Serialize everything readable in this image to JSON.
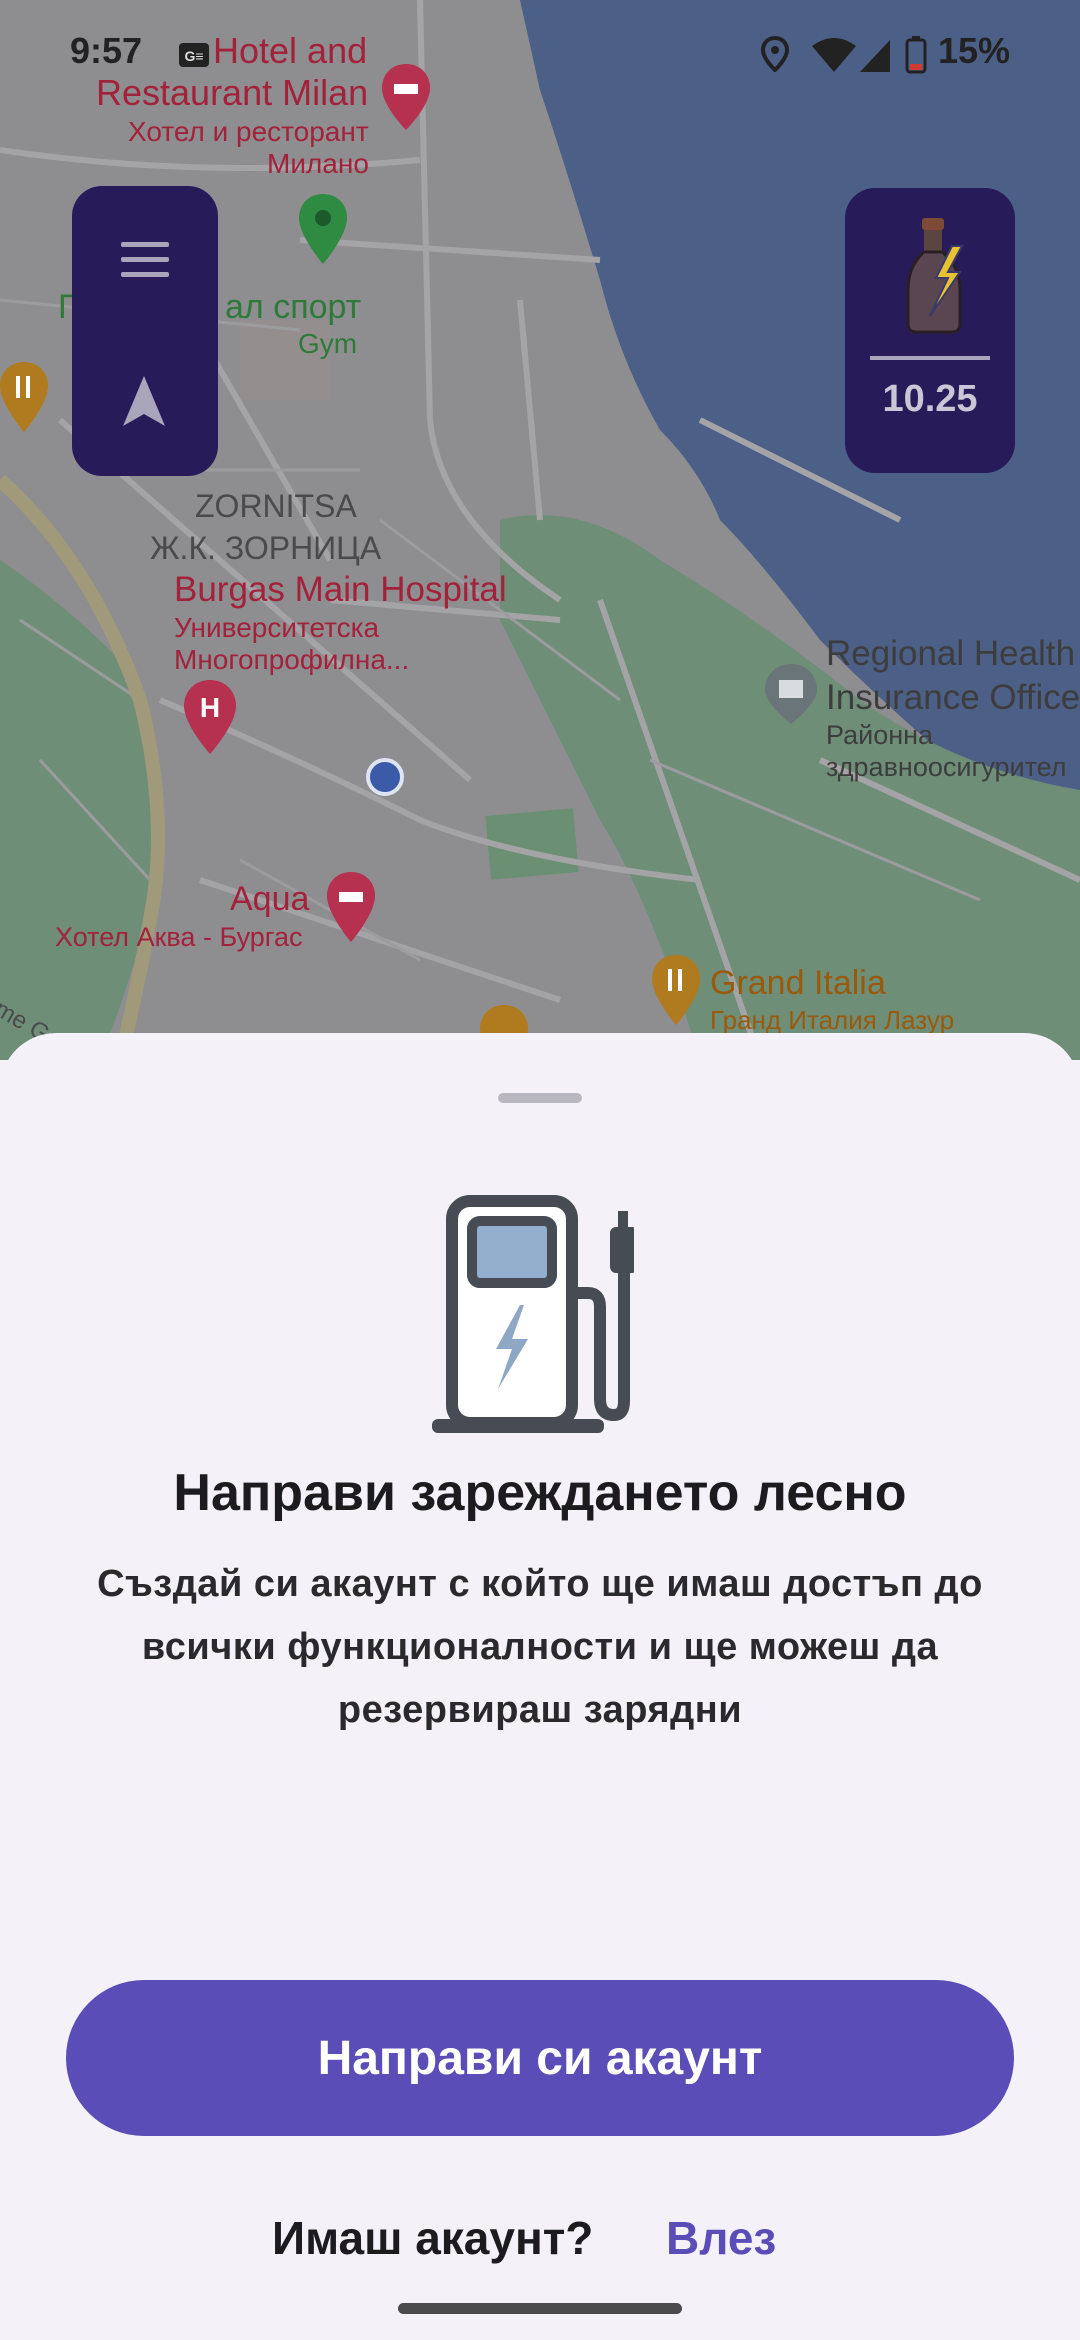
{
  "status_bar": {
    "time": "9:57",
    "battery": "15%"
  },
  "map": {
    "labels": {
      "hotel_milan_1": "Hotel and",
      "hotel_milan_2": "Restaurant Milan",
      "hotel_milan_bg_1": "Хотел и ресторант",
      "hotel_milan_bg_2": "Милано",
      "sport_1": "П",
      "sport_2": "ал спорт",
      "gym": "Gym",
      "zornitsa": "ZORNITSA",
      "zornitsa_bg": "Ж.К. ЗОРНИЦА",
      "hospital": "Burgas Main Hospital",
      "hospital_bg_1": "Университетска",
      "hospital_bg_2": "Многопрофилна...",
      "regional_1": "Regional Health",
      "regional_2": "Insurance Office",
      "regional_bg_1": "Районна",
      "regional_bg_2": "здравноосигурител",
      "aqua": "Aqua",
      "aqua_bg": "Хотел Аква - Бургас",
      "grand_italia": "Grand Italia",
      "grand_italia_bg": "Гранд Италия Лазур",
      "corner_text": "me Gr"
    },
    "colors": {
      "water": "#4c5f86",
      "land": "#8e8e90",
      "park": "#6e8e78",
      "accent": "#271b5a"
    }
  },
  "nav_pill": {
    "menu_icon": "menu-icon",
    "locate_icon": "navigation-arrow-icon"
  },
  "balance_card": {
    "icon": "lightning-bottle-icon",
    "value": "10.25"
  },
  "sheet": {
    "illustration": "ev-charging-station-icon",
    "title": "Направи зареждането лесно",
    "description": "Създай си акаунт с който ще имаш достъп до всички функционалности и ще можеш да резервираш зарядни",
    "create_button": "Направи си акаунт",
    "have_account": "Имаш акаунт?",
    "login_link": "Влез"
  }
}
